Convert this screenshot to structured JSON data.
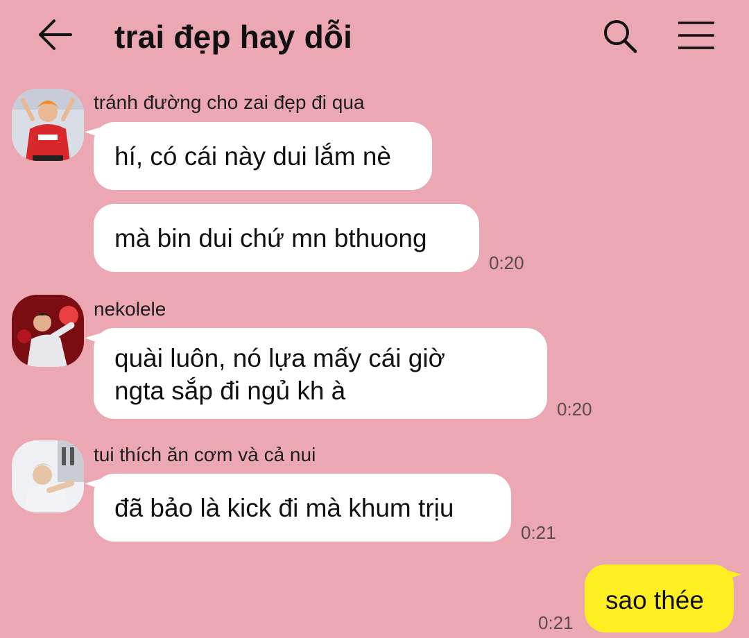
{
  "header": {
    "title": "trai đẹp hay dỗi"
  },
  "messages": [
    {
      "sender": "tránh đường cho zai đẹp đi qua",
      "text": "hí, có cái này dui lắm nè"
    },
    {
      "text": "mà bin dui chứ mn bthuong",
      "time": "0:20"
    },
    {
      "sender": "nekolele",
      "lines": [
        "quài luôn, nó lựa mấy cái giờ",
        "ngta sắp đi ngủ kh à"
      ],
      "time": "0:20"
    },
    {
      "sender": "tui thích ăn cơm và cả nui",
      "text": "đã bảo là kick đi mà khum trịu",
      "time": "0:21"
    },
    {
      "text": "sao thée",
      "time": "0:21",
      "mine": true
    }
  ],
  "colors": {
    "background": "#eca8b2",
    "incoming_bubble": "#ffffff",
    "outgoing_bubble": "#ffee22"
  },
  "icons": {
    "back": "arrow-left",
    "search": "magnifier",
    "menu": "hamburger"
  }
}
